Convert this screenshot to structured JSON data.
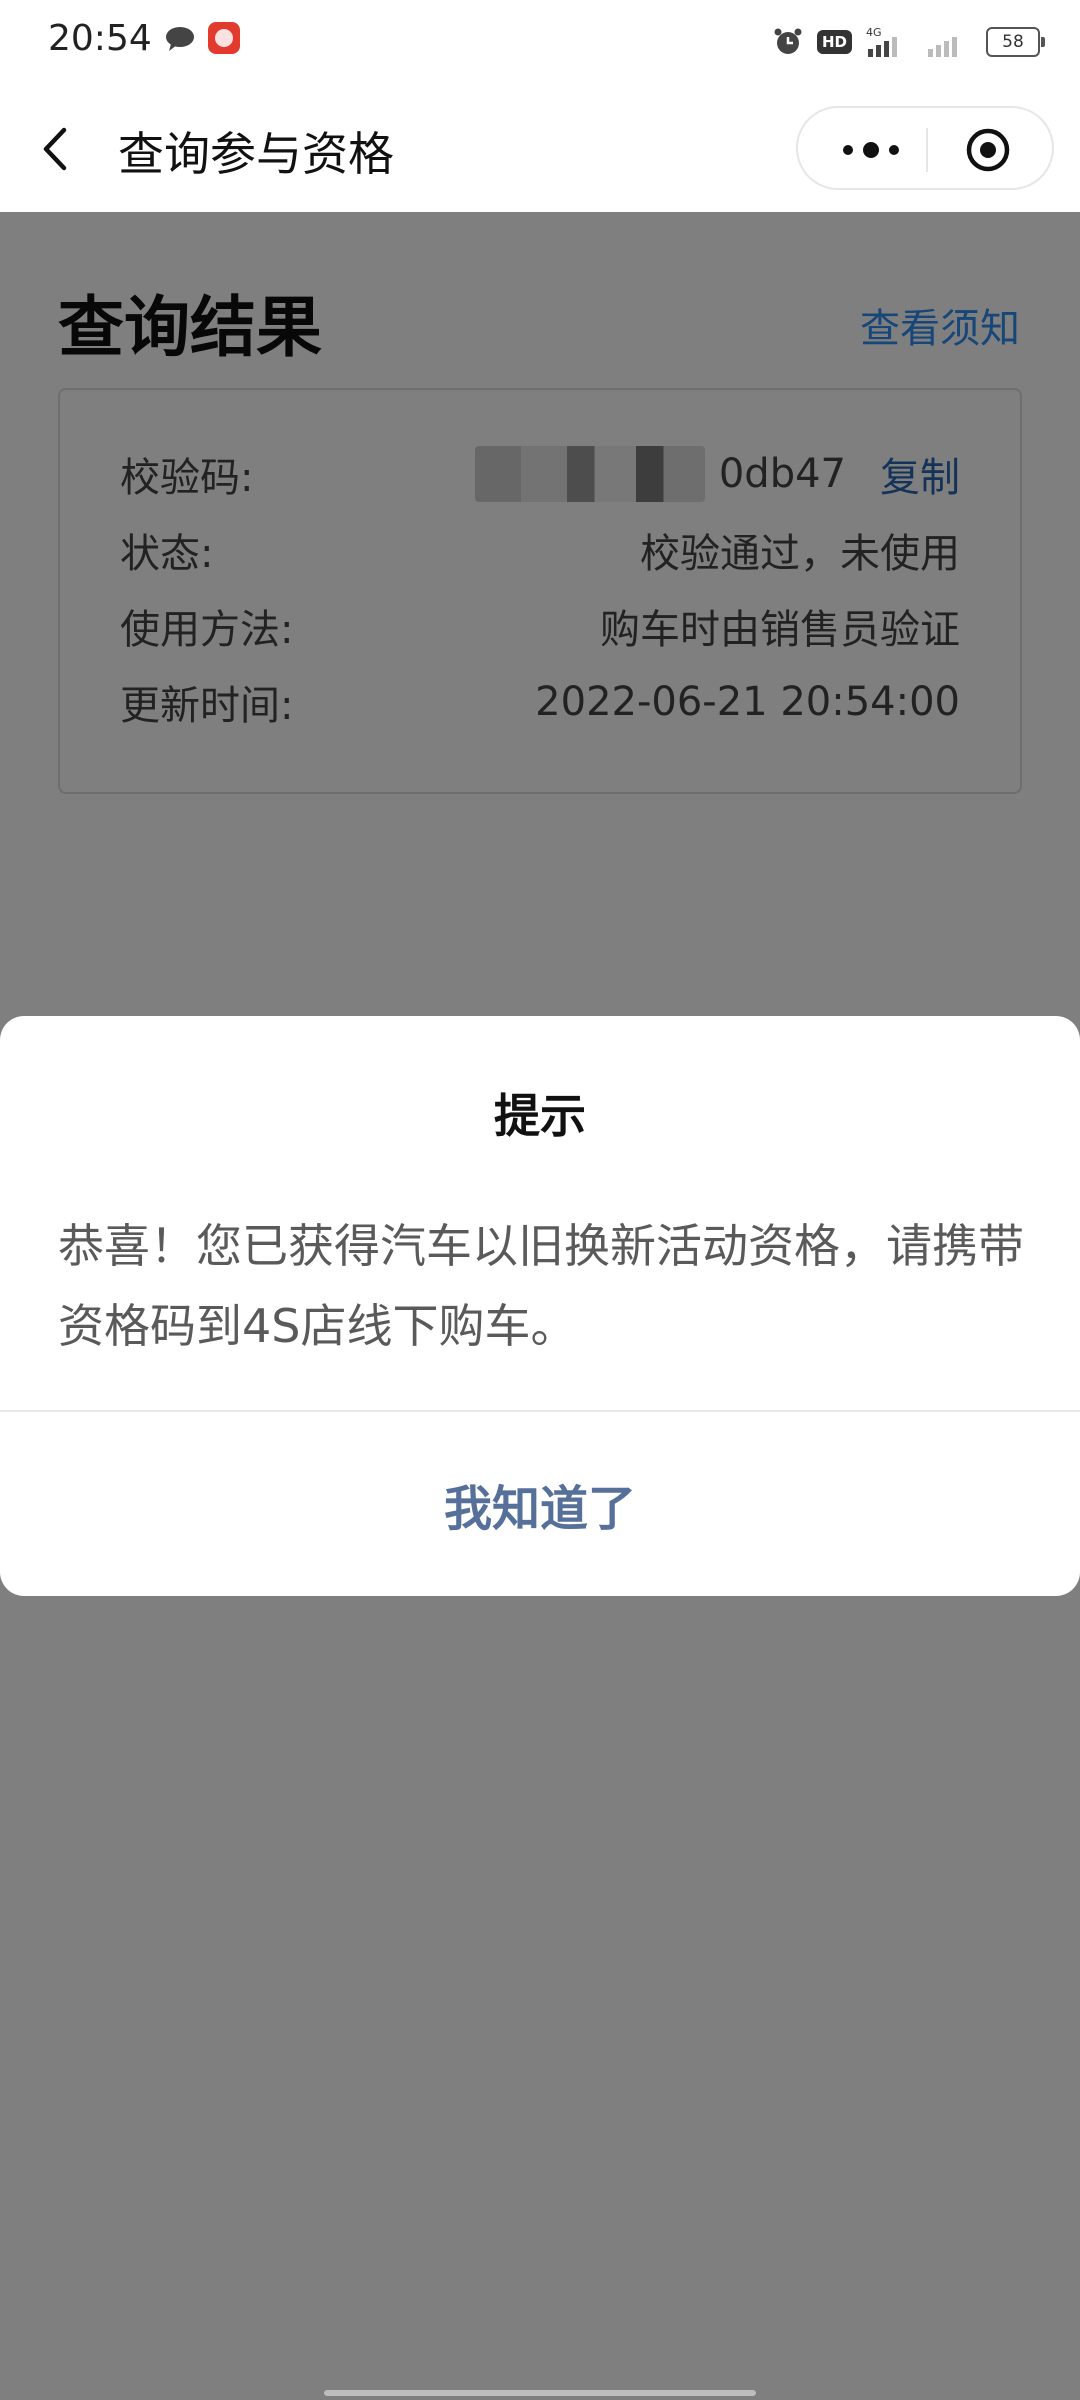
{
  "status_bar": {
    "time": "20:54",
    "hd_label": "HD",
    "network_label": "4G",
    "battery_level": "58",
    "icons": [
      "message-icon",
      "app-notification-icon",
      "alarm-icon",
      "signal-icon",
      "battery-icon"
    ]
  },
  "nav": {
    "title": "查询参与资格",
    "back_icon": "chevron-left-icon",
    "more_icon": "more-dots-icon",
    "close_icon": "target-close-icon"
  },
  "result": {
    "title": "查询结果",
    "notice_link": "查看须知",
    "rows": [
      {
        "label": "校验码:",
        "value": "0db47",
        "action": "复制"
      },
      {
        "label": "状态:",
        "value": "校验通过，未使用"
      },
      {
        "label": "使用方法:",
        "value": "购车时由销售员验证"
      },
      {
        "label": "更新时间:",
        "value": "2022-06-21 20:54:00"
      }
    ]
  },
  "dialog": {
    "title": "提示",
    "message": "恭喜！您已获得汽车以旧换新活动资格，请携带资格码到4S店线下购车。",
    "button": "我知道了"
  },
  "colors": {
    "link_blue": "#2e8cf0",
    "copy_blue": "#2b67b0",
    "dialog_button": "#56709a",
    "mask": "rgba(0,0,0,0.5)"
  }
}
